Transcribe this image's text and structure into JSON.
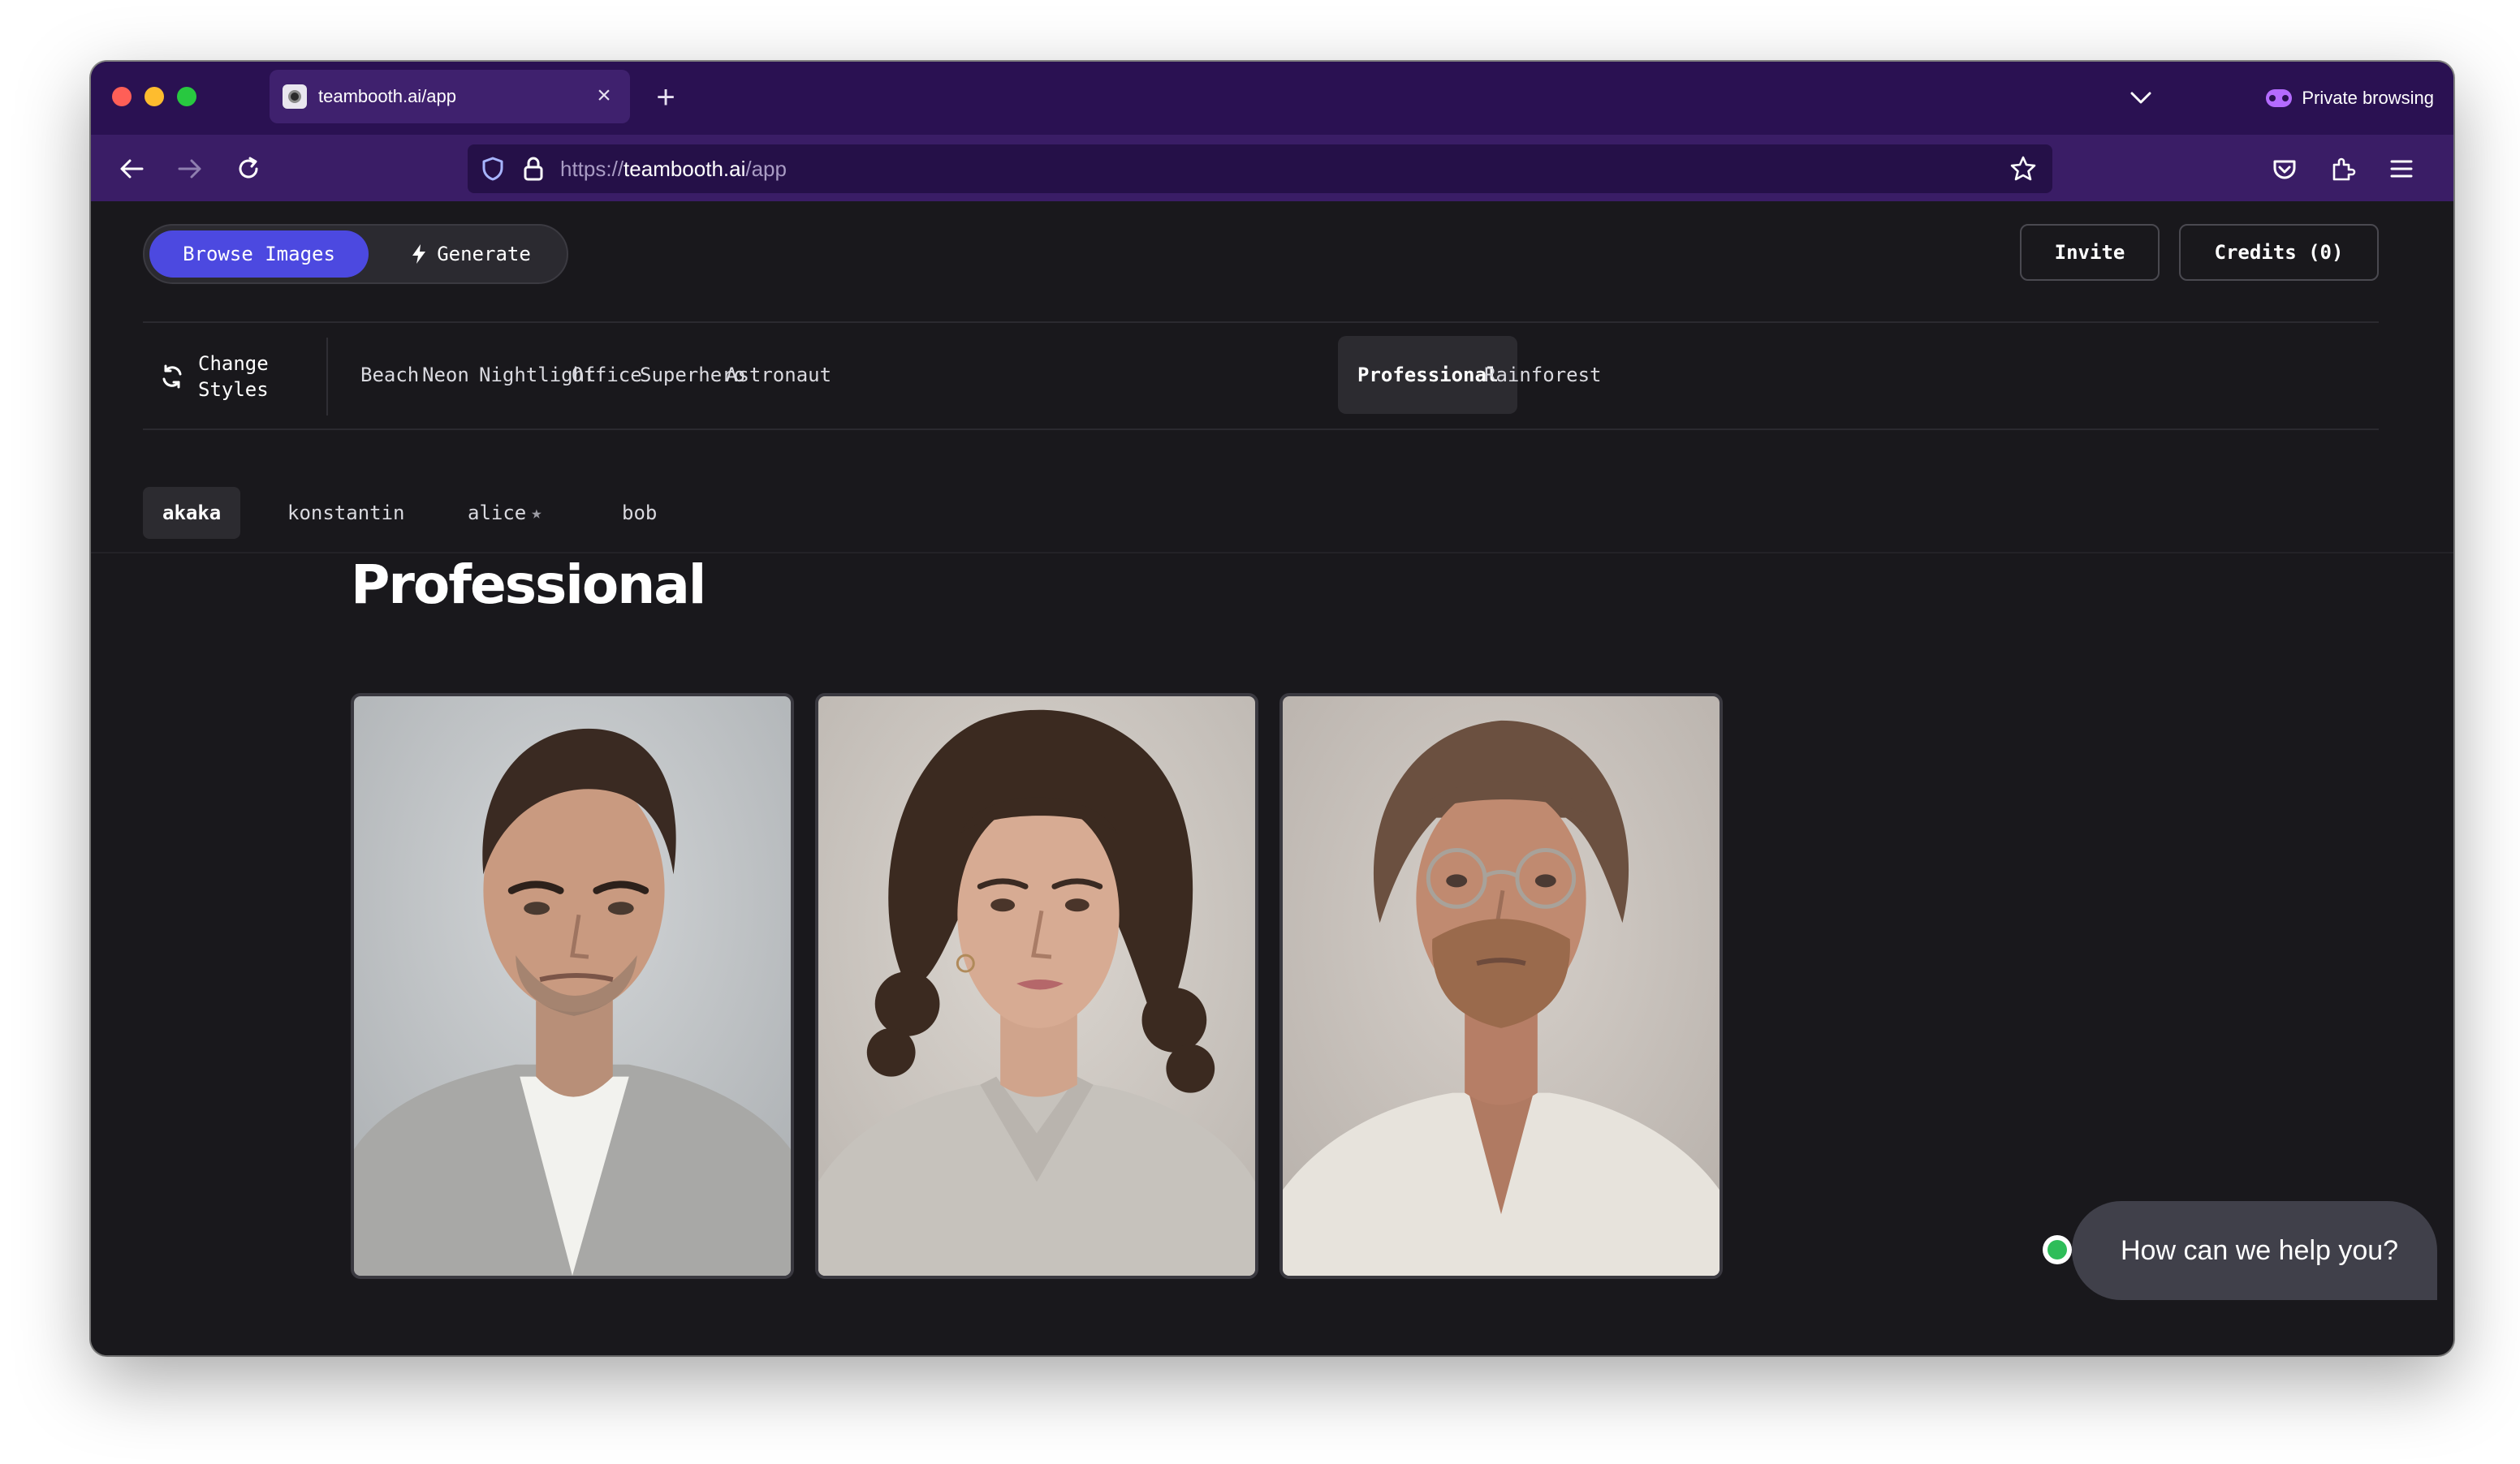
{
  "browser": {
    "tab_title": "teambooth.ai/app",
    "tab_close": "×",
    "new_tab": "+",
    "private_label": "Private browsing",
    "url_scheme": "https://",
    "url_host": "teambooth.ai",
    "url_path": "/app"
  },
  "toolbar": {
    "browse_label": "Browse Images",
    "generate_label": "Generate",
    "invite_label": "Invite",
    "credits_label": "Credits (0)"
  },
  "styles": {
    "change_line1": "Change",
    "change_line2": "Styles",
    "items": [
      {
        "label": "Beach",
        "active": false
      },
      {
        "label": "Neon",
        "active": false
      },
      {
        "label": "Nightlight",
        "active": false
      },
      {
        "label": "Office",
        "active": false
      },
      {
        "label": "Superhero",
        "active": false
      },
      {
        "label": "Astronaut",
        "active": false
      },
      {
        "label": "Professional",
        "active": true
      },
      {
        "label": "Rainforest",
        "active": false
      }
    ]
  },
  "people": {
    "items": [
      {
        "label": "akaka",
        "active": true
      },
      {
        "label": "konstantin",
        "active": false
      },
      {
        "label": "alice",
        "active": false,
        "star": "★"
      },
      {
        "label": "bob",
        "active": false
      }
    ]
  },
  "gallery": {
    "title": "Professional",
    "images": [
      {
        "subject": "man-portrait",
        "background": "#c2c5c7"
      },
      {
        "subject": "woman-curly-hair-portrait",
        "background": "#d3cdc7"
      },
      {
        "subject": "man-glasses-portrait",
        "background": "#ccc5bf"
      }
    ]
  },
  "chat": {
    "prompt": "How can we help you?",
    "status_color": "#2ebd59"
  },
  "colors": {
    "browser_purple": "#2a1152",
    "accent_blue": "#4c49e0",
    "app_background": "#19181c"
  }
}
